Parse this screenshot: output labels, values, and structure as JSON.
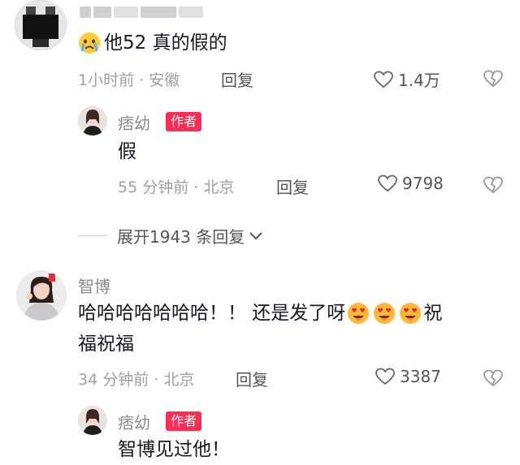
{
  "comment1": {
    "username_blurred": "",
    "text": "他52 真的假的",
    "time_location": "1小时前 · 安徽",
    "reply_label": "回复",
    "likes": "1.4万"
  },
  "reply1": {
    "username": "痞幼",
    "badge": "作者",
    "text": "假",
    "time_location": "55 分钟前 · 北京",
    "reply_label": "回复",
    "likes": "9798"
  },
  "expand": {
    "label": "展开1943 条回复"
  },
  "comment2": {
    "username": "智博",
    "text_line1": "哈哈哈哈哈哈哈！！ 还是发了呀",
    "text_line1_tail": "祝",
    "text_line2": "福祝福",
    "time_location": "34 分钟前 · 北京",
    "reply_label": "回复",
    "likes": "3387"
  },
  "reply2": {
    "username": "痞幼",
    "badge": "作者",
    "text": "智博见过他！"
  },
  "colors": {
    "author_badge": "#fe2c55",
    "meta_gray": "#a0a0a0"
  },
  "icons": [
    "crying-emoji-icon",
    "heart-outline-icon",
    "broken-heart-icon",
    "chevron-down-icon",
    "heart-eyes-emoji-icon"
  ]
}
